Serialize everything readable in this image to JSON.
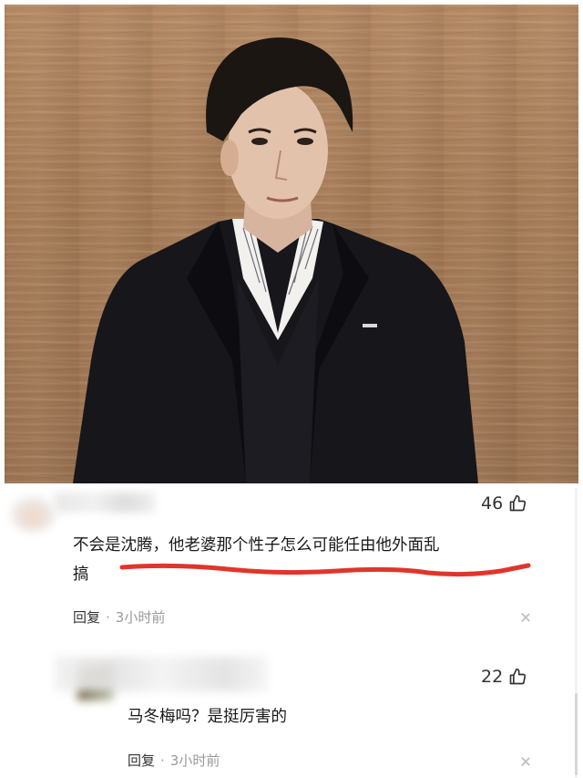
{
  "photo": {
    "subject": "man-in-dark-suit-portrait"
  },
  "comments": [
    {
      "username_blurred": true,
      "likes": "46",
      "text_line1": "不会是沈腾，他老婆那个性子怎么可能任由他外面乱",
      "text_line2": "搞",
      "reply_label": "回复",
      "separator": "·",
      "time": "3小时前",
      "underline_color": "#e0352b"
    },
    {
      "username_blurred": true,
      "username_partial": "...ich",
      "likes": "22",
      "text": "马冬梅吗？是挺厉害的",
      "reply_label": "回复",
      "separator": "·",
      "time": "3小时前"
    }
  ],
  "icons": {
    "like": "thumbs-up-icon",
    "close": "close-icon"
  }
}
